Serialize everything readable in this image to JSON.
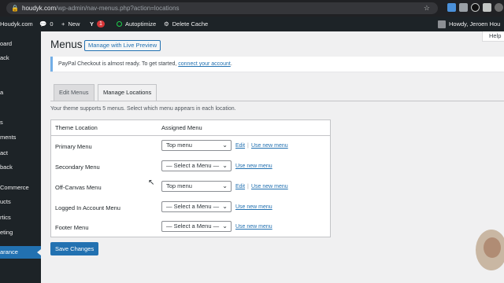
{
  "browser": {
    "url_host": "houdyk.com",
    "url_path": "/wp-admin/nav-menus.php?action=locations"
  },
  "adminbar": {
    "site": "Houdyk.com",
    "comments": "0",
    "new": "New",
    "updates": "1",
    "autoptimize": "Autoptimize",
    "delete_cache": "Delete Cache",
    "greeting": "Howdy, Jeroen Hou"
  },
  "sidebar": {
    "items": [
      {
        "label": "oard"
      },
      {
        "label": "ack"
      },
      {
        "label": "a"
      },
      {
        "label": "s"
      },
      {
        "label": "ments"
      },
      {
        "label": "act"
      },
      {
        "label": "back"
      },
      {
        "label": "Commerce"
      },
      {
        "label": "ucts"
      },
      {
        "label": "rtics"
      },
      {
        "label": "eting"
      },
      {
        "label": "arance"
      }
    ]
  },
  "header": {
    "help": "Help",
    "title": "Menus",
    "live_preview": "Manage with Live Preview"
  },
  "notice": {
    "text": "PayPal Checkout is almost ready. To get started, ",
    "link": "connect your account",
    "suffix": "."
  },
  "tabs": {
    "edit": "Edit Menus",
    "manage": "Manage Locations"
  },
  "intro": "Your theme supports 5 menus. Select which menu appears in each location.",
  "table": {
    "col_location": "Theme Location",
    "col_menu": "Assigned Menu",
    "rows": [
      {
        "location": "Primary Menu",
        "selected": "Top menu",
        "edit": "Edit",
        "use_new": "Use new menu"
      },
      {
        "location": "Secondary Menu",
        "selected": "— Select a Menu —",
        "use_new": "Use new menu"
      },
      {
        "location": "Off-Canvas Menu",
        "selected": "Top menu",
        "edit": "Edit",
        "use_new": "Use new menu"
      },
      {
        "location": "Logged In Account Menu",
        "selected": "— Select a Menu —",
        "use_new": "Use new menu"
      },
      {
        "location": "Footer Menu",
        "selected": "— Select a Menu —",
        "use_new": "Use new menu"
      }
    ]
  },
  "save": "Save Changes",
  "colors": {
    "admin_bg": "#1d2327",
    "accent": "#2271b1",
    "active_menu": "#2271b1",
    "page_bg": "#f0f0f1"
  }
}
